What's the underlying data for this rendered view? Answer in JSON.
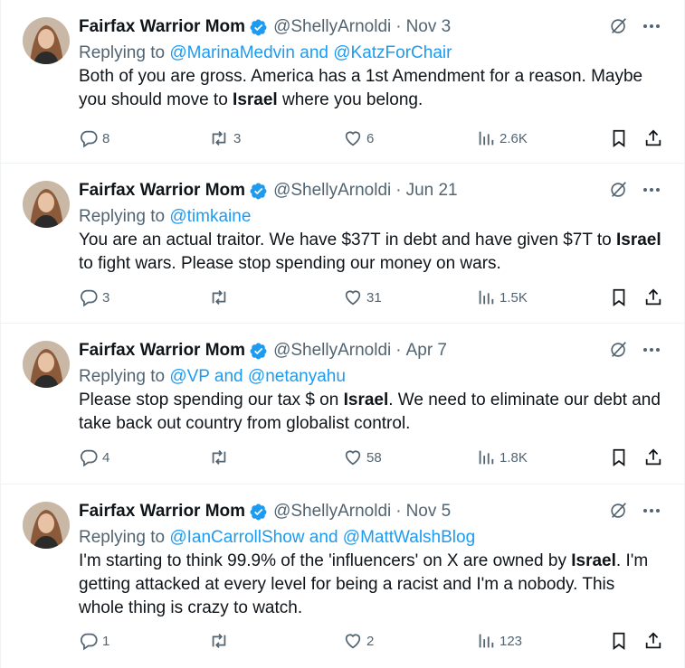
{
  "author": {
    "display_name": "Fairfax Warrior Mom",
    "handle": "@ShellyArnoldi",
    "separator": "·"
  },
  "colors": {
    "accent": "#1d9bf0",
    "muted": "#536471",
    "text": "#0f1419"
  },
  "tweets": [
    {
      "date": "Nov 3",
      "replying_prefix": "Replying to ",
      "mention1": "@MarinaMedvin",
      "and": " and ",
      "mention2": "@KatzForChair",
      "text_parts": [
        "Both of you are gross. America has a 1st Amendment for a reason. Maybe you should move to ",
        "Israel",
        " where you belong."
      ],
      "replies": "8",
      "reposts": "3",
      "likes": "6",
      "views": "2.6K"
    },
    {
      "date": "Jun 21",
      "replying_prefix": "Replying to ",
      "mention1": "@timkaine",
      "and": "",
      "mention2": "",
      "text_parts": [
        "You are an actual traitor. We have $37T in debt and have given $7T to ",
        "Israel",
        " to fight wars. Please stop spending our money on wars."
      ],
      "replies": "3",
      "reposts": "",
      "likes": "31",
      "views": "1.5K"
    },
    {
      "date": "Apr 7",
      "replying_prefix": "Replying to ",
      "mention1": "@VP",
      "and": " and ",
      "mention2": "@netanyahu",
      "text_parts": [
        "Please stop spending our tax $ on ",
        "Israel",
        ". We need to eliminate our debt and take back out country from globalist control."
      ],
      "replies": "4",
      "reposts": "",
      "likes": "58",
      "views": "1.8K"
    },
    {
      "date": "Nov 5",
      "replying_prefix": "Replying to ",
      "mention1": "@IanCarrollShow",
      "and": " and ",
      "mention2": "@MattWalshBlog",
      "text_parts": [
        "I'm starting to think 99.9% of the 'influencers' on X are owned by ",
        "Israel",
        ".  I'm getting attacked at every level for being a racist and I'm a nobody. This whole thing is crazy to watch."
      ],
      "replies": "1",
      "reposts": "",
      "likes": "2",
      "views": "123"
    }
  ]
}
